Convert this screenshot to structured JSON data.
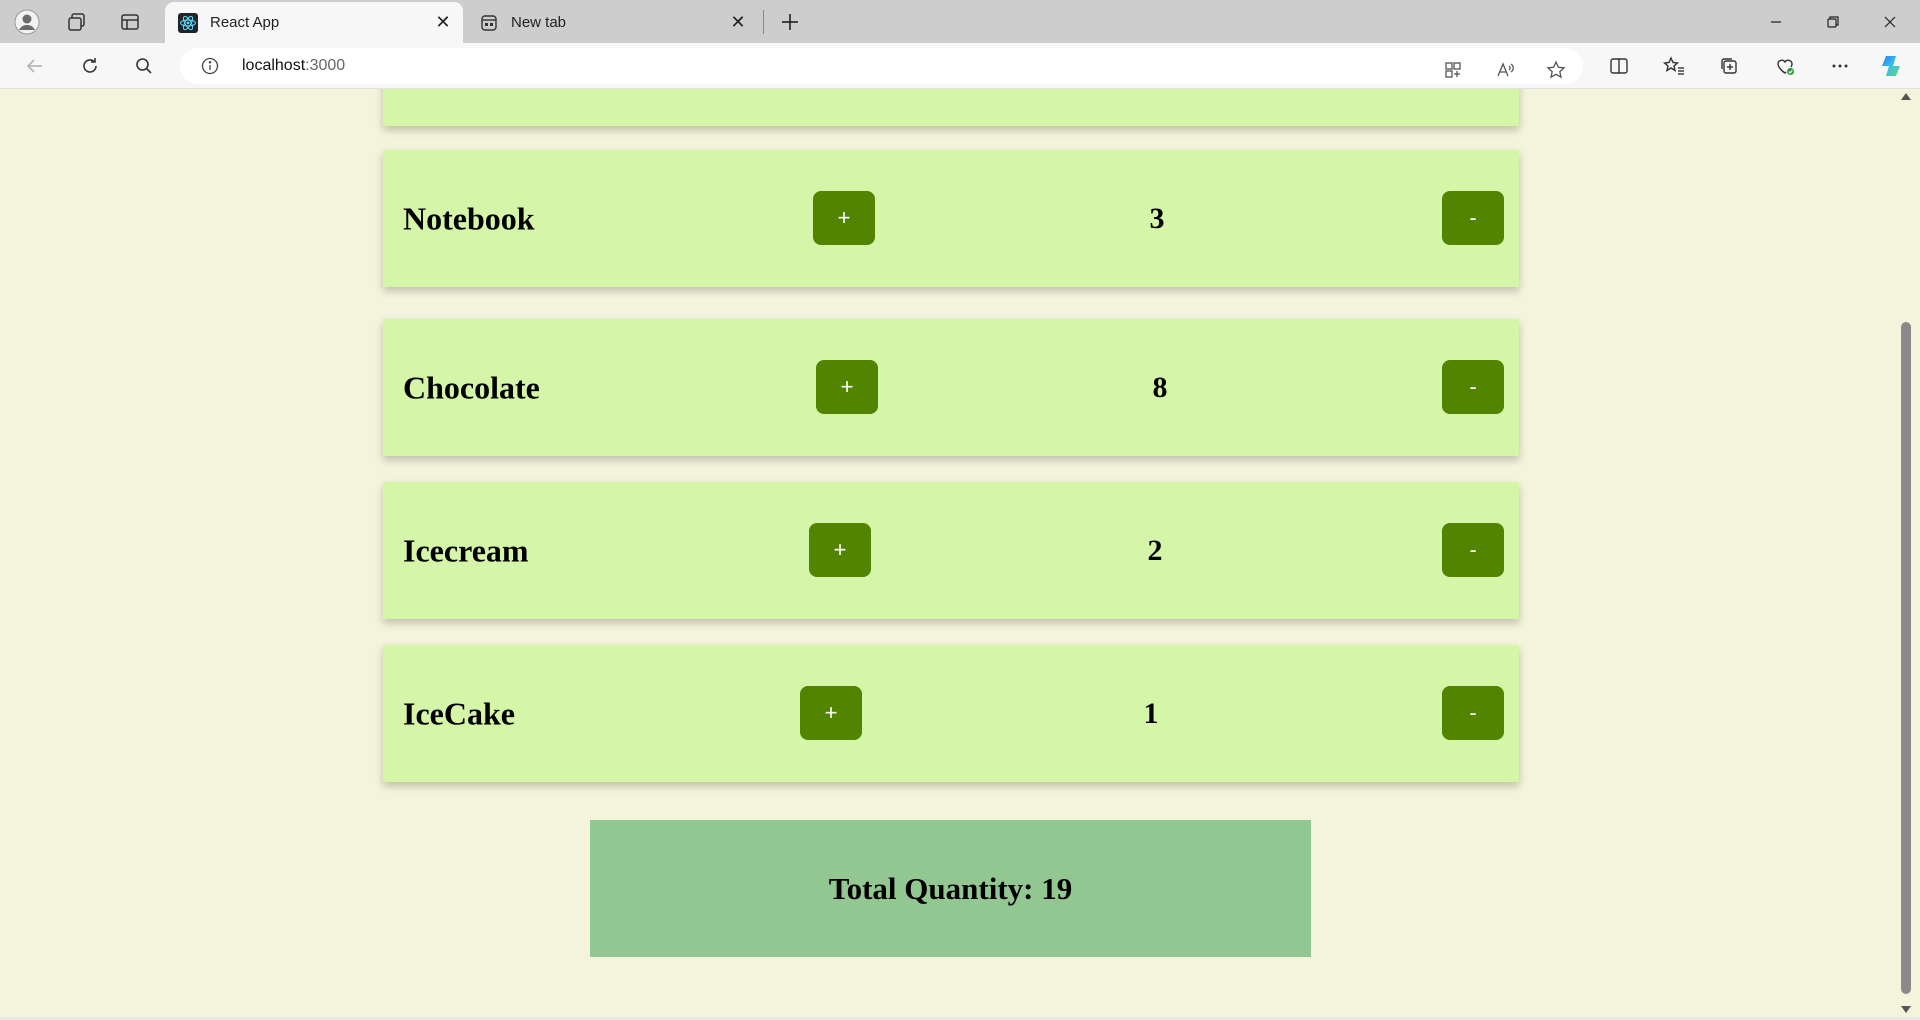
{
  "browser": {
    "tabs": [
      {
        "title": "React App",
        "active": true
      },
      {
        "title": "New tab",
        "active": false
      }
    ],
    "url_host": "localhost",
    "url_port": ":3000",
    "accent_colors": {
      "tab_strip": "#cdcdcd",
      "toolbar": "#f7f7f7"
    }
  },
  "page": {
    "items": [
      {
        "name": "Notebook",
        "quantity": "3",
        "plus_label": "+",
        "minus_label": "-"
      },
      {
        "name": "Chocolate",
        "quantity": "8",
        "plus_label": "+",
        "minus_label": "-"
      },
      {
        "name": "Icecream",
        "quantity": "2",
        "plus_label": "+",
        "minus_label": "-"
      },
      {
        "name": "IceCake",
        "quantity": "1",
        "plus_label": "+",
        "minus_label": "-"
      }
    ],
    "total_label": "Total Quantity: 19",
    "colors": {
      "background": "#f4f4dc",
      "card": "#d5f5a8",
      "button": "#528400",
      "total_box": "#93c791"
    }
  }
}
